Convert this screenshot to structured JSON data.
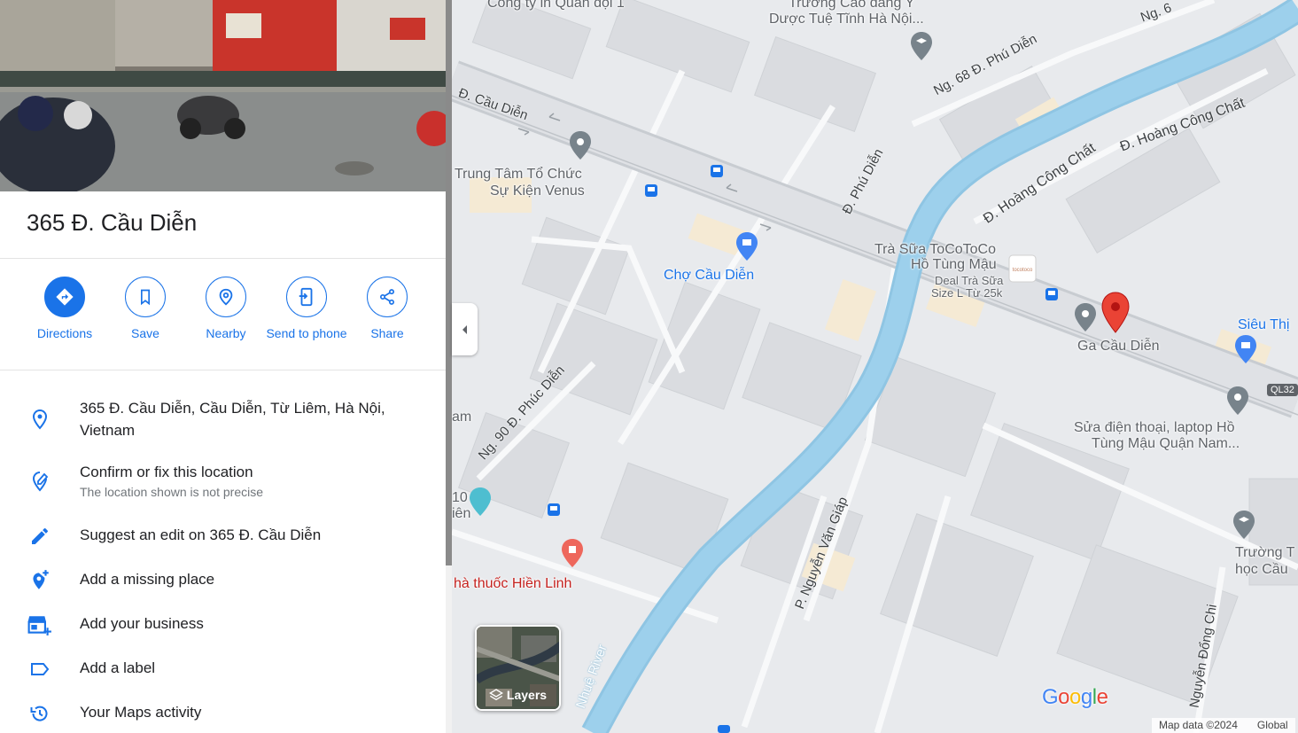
{
  "place": {
    "title": "365 Đ. Cầu Diễn"
  },
  "actions": [
    {
      "label": "Directions",
      "icon": "directions-icon"
    },
    {
      "label": "Save",
      "icon": "bookmark-icon"
    },
    {
      "label": "Nearby",
      "icon": "nearby-icon"
    },
    {
      "label": "Send to phone",
      "icon": "send-to-phone-icon"
    },
    {
      "label": "Share",
      "icon": "share-icon"
    }
  ],
  "info": {
    "address": "365 Đ. Cầu Diễn, Cầu Diễn, Từ Liêm, Hà Nội, Vietnam",
    "confirm_title": "Confirm or fix this location",
    "confirm_sub": "The location shown is not precise",
    "suggest_edit": "Suggest an edit on 365 Đ. Cầu Diễn",
    "add_missing": "Add a missing place",
    "add_business": "Add your business",
    "add_label": "Add a label",
    "maps_activity": "Your Maps activity"
  },
  "map": {
    "labels": {
      "cong_ty": "Công ty in Quân đội 1",
      "truong_cao_dang": "Trường Cao đẳng Y",
      "duoc_tue_tinh": "Dược Tuệ Tĩnh Hà Nội...",
      "trung_tam_1": "Trung Tâm Tổ Chức",
      "trung_tam_2": "Sự Kiện Venus",
      "cho_cau_dien": "Chợ Cầu Diễn",
      "tra_sua_1": "Trà Sữa ToCoToCo",
      "tra_sua_2": "Hồ Tùng Mậu",
      "deal_1": "Deal Trà Sữa",
      "deal_2": "Size L Từ 25k",
      "ga_cau_dien": "Ga Cầu Diễn",
      "sieu_thi": "Siêu Thị",
      "sua_dien_thoai_1": "Sửa điện thoại, laptop Hồ",
      "sua_dien_thoai_2": "Tùng Mậu Quận Nam...",
      "truong_t": "Trường T",
      "hoc_cau": "học Cầu",
      "nha_thuoc": "hà thuốc Hiền Linh",
      "am": "am",
      "ten": "10",
      "ien": "iên"
    },
    "streets": {
      "cau_dien": "Đ. Cầu Diễn",
      "phu_dien": "Đ. Phú Diễn",
      "ng68": "Ng. 68 Đ. Phú Diễn",
      "hoang_cong_chat_1": "Đ. Hoàng Công Chất",
      "hoang_cong_chat_2": "Đ. Hoàng Công Chất",
      "ng90": "Ng. 90 Đ. Phúc Diễn",
      "nguyen_van_giap": "P. Nguyễn Văn Giáp",
      "nhue_river": "Nhuệ River",
      "nguyen_dong_chi": "Nguyễn Đổng Chi",
      "ng_top": "Ng. 6"
    },
    "route_badge": "QL32",
    "layers_label": "Layers",
    "attribution_data": "Map data ©2024",
    "attribution_region": "Global",
    "google_letters": [
      "G",
      "o",
      "o",
      "g",
      "l",
      "e"
    ],
    "google_colors": [
      "#4285f4",
      "#ea4335",
      "#fbbc05",
      "#4285f4",
      "#34a853",
      "#ea4335"
    ],
    "pin_color": "#ea4335"
  }
}
